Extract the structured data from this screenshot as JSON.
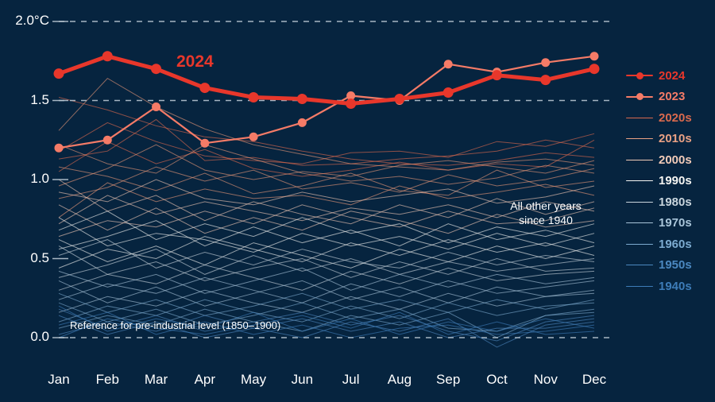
{
  "chart_data": {
    "type": "line",
    "title": "",
    "xlabel": "",
    "ylabel": "",
    "categories": [
      "Jan",
      "Feb",
      "Mar",
      "Apr",
      "May",
      "Jun",
      "Jul",
      "Aug",
      "Sep",
      "Oct",
      "Nov",
      "Dec"
    ],
    "ylim": [
      -0.12,
      2.06
    ],
    "yticks": [
      0.0,
      0.5,
      1.0,
      1.5,
      2.0
    ],
    "ytick_labels": [
      "0.0",
      "0.5",
      "1.0",
      "1.5",
      "2.0°C"
    ],
    "grid": "horizontal-dashed",
    "legend_position": "right",
    "reference_line": 0.0,
    "series": [
      {
        "name": "2024",
        "color": "#e8372b",
        "width": 5,
        "markers": true,
        "values": [
          1.67,
          1.78,
          1.7,
          1.58,
          1.52,
          1.51,
          1.48,
          1.51,
          1.55,
          1.66,
          1.63,
          1.7
        ]
      },
      {
        "name": "2023",
        "color": "#f57b67",
        "width": 2.2,
        "markers": true,
        "values": [
          1.2,
          1.25,
          1.46,
          1.23,
          1.27,
          1.36,
          1.53,
          1.5,
          1.73,
          1.68,
          1.74,
          1.78
        ]
      }
    ],
    "background_series_label": "All other years since 1940",
    "background_decades": [
      {
        "name": "2020s",
        "color": "#e06a4e"
      },
      {
        "name": "2010s",
        "color": "#e89878"
      },
      {
        "name": "2000s",
        "color": "#f0c8b4"
      },
      {
        "name": "1990s",
        "color": "#f4f4f0"
      },
      {
        "name": "1980s",
        "color": "#c8d4dc"
      },
      {
        "name": "1970s",
        "color": "#a8c4d8"
      },
      {
        "name": "1960s",
        "color": "#7ba8cc"
      },
      {
        "name": "1950s",
        "color": "#4d86bd"
      },
      {
        "name": "1940s",
        "color": "#3d7cb8"
      }
    ],
    "background_lines": [
      {
        "decade": "2020s",
        "values": [
          1.18,
          1.36,
          1.24,
          1.15,
          1.12,
          1.1,
          1.17,
          1.18,
          1.14,
          1.24,
          1.21,
          1.29
        ]
      },
      {
        "decade": "2020s",
        "values": [
          1.13,
          1.18,
          1.38,
          1.12,
          1.14,
          1.09,
          1.1,
          1.13,
          1.15,
          1.18,
          1.25,
          1.2
        ]
      },
      {
        "decade": "2020s",
        "values": [
          1.52,
          1.44,
          1.34,
          1.27,
          1.24,
          1.18,
          1.13,
          1.1,
          1.09,
          1.12,
          1.17,
          1.14
        ]
      },
      {
        "decade": "2020s",
        "values": [
          1.05,
          1.24,
          1.1,
          1.19,
          1.07,
          1.02,
          1.06,
          1.11,
          1.06,
          1.1,
          1.08,
          1.25
        ]
      },
      {
        "decade": "2010s",
        "values": [
          1.31,
          1.64,
          1.46,
          1.32,
          1.22,
          1.16,
          1.1,
          1.08,
          1.06,
          1.11,
          1.13,
          1.09
        ]
      },
      {
        "decade": "2010s",
        "values": [
          0.96,
          1.07,
          1.22,
          1.06,
          1.0,
          1.05,
          1.02,
          1.09,
          1.12,
          1.08,
          1.04,
          1.12
        ]
      },
      {
        "decade": "2010s",
        "values": [
          1.22,
          1.1,
          1.04,
          1.22,
          1.13,
          1.04,
          0.99,
          1.02,
          0.97,
          1.01,
          1.09,
          1.04
        ]
      },
      {
        "decade": "2010s",
        "values": [
          0.88,
          0.95,
          1.08,
          0.99,
          1.06,
          0.94,
          0.98,
          0.92,
          1.03,
          0.96,
          1.0,
          1.07
        ]
      },
      {
        "decade": "2010s",
        "values": [
          1.08,
          1.02,
          0.93,
          1.04,
          0.91,
          0.96,
          1.04,
          0.93,
          0.9,
          1.06,
          0.95,
          0.99
        ]
      },
      {
        "decade": "2010s",
        "values": [
          0.76,
          0.98,
          0.86,
          0.94,
          0.88,
          0.9,
          0.84,
          0.96,
          0.88,
          0.92,
          0.97,
          0.9
        ]
      },
      {
        "decade": "2000s",
        "values": [
          0.92,
          0.86,
          1.0,
          0.88,
          0.84,
          0.92,
          0.86,
          0.9,
          0.94,
          0.85,
          0.89,
          0.96
        ]
      },
      {
        "decade": "2000s",
        "values": [
          0.72,
          0.9,
          0.78,
          0.86,
          0.8,
          0.74,
          0.82,
          0.78,
          0.84,
          0.76,
          0.86,
          0.8
        ]
      },
      {
        "decade": "2000s",
        "values": [
          1.0,
          0.8,
          0.9,
          0.74,
          0.86,
          0.78,
          0.72,
          0.84,
          0.76,
          0.88,
          0.78,
          0.86
        ]
      },
      {
        "decade": "2000s",
        "values": [
          0.64,
          0.74,
          0.7,
          0.8,
          0.72,
          0.84,
          0.76,
          0.7,
          0.8,
          0.72,
          0.74,
          0.82
        ]
      },
      {
        "decade": "2000s",
        "values": [
          0.84,
          0.68,
          0.82,
          0.66,
          0.76,
          0.68,
          0.8,
          0.74,
          0.66,
          0.78,
          0.7,
          0.74
        ]
      },
      {
        "decade": "1990s",
        "values": [
          0.68,
          0.8,
          0.62,
          0.72,
          0.64,
          0.76,
          0.66,
          0.72,
          0.6,
          0.7,
          0.64,
          0.72
        ]
      },
      {
        "decade": "1990s",
        "values": [
          0.56,
          0.64,
          0.74,
          0.58,
          0.7,
          0.6,
          0.68,
          0.58,
          0.72,
          0.62,
          0.68,
          0.6
        ]
      },
      {
        "decade": "1990s",
        "values": [
          0.76,
          0.58,
          0.66,
          0.62,
          0.54,
          0.66,
          0.58,
          0.64,
          0.56,
          0.66,
          0.58,
          0.66
        ]
      },
      {
        "decade": "1990s",
        "values": [
          0.44,
          0.56,
          0.5,
          0.64,
          0.56,
          0.48,
          0.6,
          0.52,
          0.62,
          0.54,
          0.6,
          0.52
        ]
      },
      {
        "decade": "1990s",
        "values": [
          0.62,
          0.48,
          0.58,
          0.46,
          0.6,
          0.52,
          0.44,
          0.56,
          0.48,
          0.58,
          0.5,
          0.58
        ]
      },
      {
        "decade": "1980s",
        "values": [
          0.52,
          0.62,
          0.44,
          0.54,
          0.46,
          0.56,
          0.48,
          0.44,
          0.54,
          0.46,
          0.52,
          0.48
        ]
      },
      {
        "decade": "1980s",
        "values": [
          0.38,
          0.46,
          0.56,
          0.4,
          0.52,
          0.42,
          0.5,
          0.4,
          0.48,
          0.42,
          0.46,
          0.5
        ]
      },
      {
        "decade": "1980s",
        "values": [
          0.58,
          0.4,
          0.48,
          0.36,
          0.44,
          0.5,
          0.38,
          0.48,
          0.4,
          0.5,
          0.42,
          0.44
        ]
      },
      {
        "decade": "1980s",
        "values": [
          0.3,
          0.4,
          0.34,
          0.46,
          0.38,
          0.3,
          0.42,
          0.34,
          0.44,
          0.36,
          0.4,
          0.42
        ]
      },
      {
        "decade": "1970s",
        "values": [
          0.42,
          0.32,
          0.4,
          0.28,
          0.36,
          0.44,
          0.3,
          0.4,
          0.32,
          0.4,
          0.34,
          0.38
        ]
      },
      {
        "decade": "1970s",
        "values": [
          0.24,
          0.34,
          0.28,
          0.38,
          0.3,
          0.22,
          0.34,
          0.26,
          0.36,
          0.28,
          0.32,
          0.36
        ]
      },
      {
        "decade": "1970s",
        "values": [
          0.36,
          0.22,
          0.32,
          0.2,
          0.28,
          0.36,
          0.24,
          0.32,
          0.22,
          0.32,
          0.26,
          0.3
        ]
      },
      {
        "decade": "1970s",
        "values": [
          0.16,
          0.26,
          0.2,
          0.3,
          0.22,
          0.16,
          0.26,
          0.18,
          0.28,
          0.2,
          0.26,
          0.28
        ]
      },
      {
        "decade": "1960s",
        "values": [
          0.28,
          0.16,
          0.24,
          0.14,
          0.2,
          0.28,
          0.18,
          0.24,
          0.16,
          0.24,
          0.18,
          0.24
        ]
      },
      {
        "decade": "1960s",
        "values": [
          0.1,
          0.2,
          0.14,
          0.24,
          0.16,
          0.1,
          0.2,
          0.12,
          0.22,
          0.14,
          0.2,
          0.22
        ]
      },
      {
        "decade": "1960s",
        "values": [
          0.22,
          0.1,
          0.18,
          0.08,
          0.14,
          0.22,
          0.12,
          0.18,
          0.06,
          0.04,
          0.14,
          0.18
        ]
      },
      {
        "decade": "1960s",
        "values": [
          0.06,
          0.14,
          0.08,
          0.18,
          0.1,
          0.04,
          0.14,
          0.08,
          0.16,
          0.0,
          0.14,
          0.16
        ]
      },
      {
        "decade": "1950s",
        "values": [
          0.18,
          0.06,
          0.14,
          0.04,
          0.1,
          0.16,
          0.08,
          0.14,
          0.04,
          -0.02,
          0.1,
          0.14
        ]
      },
      {
        "decade": "1950s",
        "values": [
          0.02,
          0.1,
          0.04,
          0.14,
          0.06,
          0.0,
          0.1,
          0.04,
          0.12,
          -0.06,
          0.08,
          0.12
        ]
      },
      {
        "decade": "1950s",
        "values": [
          0.14,
          0.02,
          0.1,
          0.0,
          0.06,
          0.12,
          0.04,
          0.1,
          0.0,
          0.06,
          0.06,
          0.1
        ]
      },
      {
        "decade": "1940s",
        "values": [
          0.08,
          0.16,
          0.02,
          0.1,
          0.02,
          0.08,
          0.0,
          0.06,
          0.08,
          0.02,
          0.04,
          0.08
        ]
      },
      {
        "decade": "1940s",
        "values": [
          0.2,
          0.04,
          0.12,
          0.06,
          0.16,
          0.04,
          0.12,
          0.02,
          0.1,
          0.04,
          0.12,
          0.06
        ]
      },
      {
        "decade": "1940s",
        "values": [
          0.0,
          0.12,
          0.06,
          0.02,
          0.08,
          0.14,
          0.06,
          0.16,
          0.02,
          0.1,
          0.02,
          0.04
        ]
      }
    ]
  },
  "yaxis": {
    "ticks": [
      {
        "label": "2.0°C",
        "value": 2.0
      },
      {
        "label": "1.5",
        "value": 1.5
      },
      {
        "label": "1.0",
        "value": 1.0
      },
      {
        "label": "0.5",
        "value": 0.5
      },
      {
        "label": "0.0",
        "value": 0.0
      }
    ]
  },
  "xaxis": {
    "ticks": [
      "Jan",
      "Feb",
      "Mar",
      "Apr",
      "May",
      "Jun",
      "Jul",
      "Aug",
      "Sep",
      "Oct",
      "Nov",
      "Dec"
    ]
  },
  "annotations": {
    "series_tag_2024": "2024",
    "all_other_years_line1": "All other years",
    "all_other_years_line2": "since 1940",
    "reference_note": "Reference for pre-industrial level (1850–1900)"
  },
  "legend": {
    "items": [
      {
        "label": "2024",
        "color": "#e8372b",
        "marker": true,
        "thick": true
      },
      {
        "label": "2023",
        "color": "#f57b67",
        "marker": true,
        "thick": true
      },
      {
        "label": "2020s",
        "color": "#d9694d",
        "marker": false,
        "thick": false
      },
      {
        "label": "2010s",
        "color": "#e9a184",
        "marker": false,
        "thick": false
      },
      {
        "label": "2000s",
        "color": "#f2cbb8",
        "marker": false,
        "thick": false
      },
      {
        "label": "1990s",
        "color": "#f5f5f2",
        "marker": false,
        "thick": false
      },
      {
        "label": "1980s",
        "color": "#cad6de",
        "marker": false,
        "thick": false
      },
      {
        "label": "1970s",
        "color": "#a9c5d9",
        "marker": false,
        "thick": false
      },
      {
        "label": "1960s",
        "color": "#7cabd0",
        "marker": false,
        "thick": false
      },
      {
        "label": "1950s",
        "color": "#4b88c0",
        "marker": false,
        "thick": false
      },
      {
        "label": "1940s",
        "color": "#3d7cb8",
        "marker": false,
        "thick": false
      }
    ]
  },
  "colors": {
    "background": "#06243f",
    "accent_2024": "#e8372b",
    "accent_2023": "#f57b67",
    "grid": "#b9c6d2",
    "text": "#ffffff"
  }
}
